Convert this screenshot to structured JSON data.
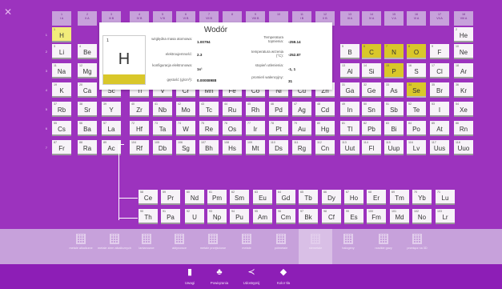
{
  "groups": [
    {
      "num": "1",
      "label": "I A"
    },
    {
      "num": "2",
      "label": "II A"
    },
    {
      "num": "3",
      "label": "III B"
    },
    {
      "num": "4",
      "label": "IV B"
    },
    {
      "num": "5",
      "label": "V B"
    },
    {
      "num": "6",
      "label": "VI B"
    },
    {
      "num": "7",
      "label": "VII B"
    },
    {
      "num": "8",
      "label": ""
    },
    {
      "num": "9",
      "label": "VIII B"
    },
    {
      "num": "10",
      "label": ""
    },
    {
      "num": "11",
      "label": "I B"
    },
    {
      "num": "12",
      "label": "II B"
    },
    {
      "num": "13",
      "label": "III A"
    },
    {
      "num": "14",
      "label": "IV A"
    },
    {
      "num": "15",
      "label": "V A"
    },
    {
      "num": "16",
      "label": "VI A"
    },
    {
      "num": "17",
      "label": "VII A"
    },
    {
      "num": "18",
      "label": "VIII A"
    }
  ],
  "periods": [
    "1",
    "2",
    "3",
    "4",
    "5",
    "6",
    "7"
  ],
  "elements": [
    [
      "1",
      "H"
    ],
    [
      "2",
      "He"
    ],
    [
      "3",
      "Li"
    ],
    [
      "4",
      "Be"
    ],
    [
      "5",
      "B"
    ],
    [
      "6",
      "C"
    ],
    [
      "7",
      "N"
    ],
    [
      "8",
      "O"
    ],
    [
      "9",
      "F"
    ],
    [
      "10",
      "Ne"
    ],
    [
      "11",
      "Na"
    ],
    [
      "12",
      "Mg"
    ],
    [
      "13",
      "Al"
    ],
    [
      "14",
      "Si"
    ],
    [
      "15",
      "P"
    ],
    [
      "16",
      "S"
    ],
    [
      "17",
      "Cl"
    ],
    [
      "18",
      "Ar"
    ],
    [
      "19",
      "K"
    ],
    [
      "20",
      "Ca"
    ],
    [
      "21",
      "Sc"
    ],
    [
      "22",
      "Ti"
    ],
    [
      "23",
      "V"
    ],
    [
      "24",
      "Cr"
    ],
    [
      "25",
      "Mn"
    ],
    [
      "26",
      "Fe"
    ],
    [
      "27",
      "Co"
    ],
    [
      "28",
      "Ni"
    ],
    [
      "29",
      "Cu"
    ],
    [
      "30",
      "Zn"
    ],
    [
      "31",
      "Ga"
    ],
    [
      "32",
      "Ge"
    ],
    [
      "33",
      "As"
    ],
    [
      "34",
      "Se"
    ],
    [
      "35",
      "Br"
    ],
    [
      "36",
      "Kr"
    ],
    [
      "37",
      "Rb"
    ],
    [
      "38",
      "Sr"
    ],
    [
      "39",
      "Y"
    ],
    [
      "40",
      "Zr"
    ],
    [
      "41",
      "Nb"
    ],
    [
      "42",
      "Mo"
    ],
    [
      "43",
      "Tc"
    ],
    [
      "44",
      "Ru"
    ],
    [
      "45",
      "Rh"
    ],
    [
      "46",
      "Pd"
    ],
    [
      "47",
      "Ag"
    ],
    [
      "48",
      "Cd"
    ],
    [
      "49",
      "In"
    ],
    [
      "50",
      "Sn"
    ],
    [
      "51",
      "Sb"
    ],
    [
      "52",
      "Te"
    ],
    [
      "53",
      "I"
    ],
    [
      "54",
      "Xe"
    ],
    [
      "55",
      "Cs"
    ],
    [
      "56",
      "Ba"
    ],
    [
      "57",
      "La"
    ],
    [
      "72",
      "Hf"
    ],
    [
      "73",
      "Ta"
    ],
    [
      "74",
      "W"
    ],
    [
      "75",
      "Re"
    ],
    [
      "76",
      "Os"
    ],
    [
      "77",
      "Ir"
    ],
    [
      "78",
      "Pt"
    ],
    [
      "79",
      "Au"
    ],
    [
      "80",
      "Hg"
    ],
    [
      "81",
      "Tl"
    ],
    [
      "82",
      "Pb"
    ],
    [
      "83",
      "Bi"
    ],
    [
      "84",
      "Po"
    ],
    [
      "85",
      "At"
    ],
    [
      "86",
      "Rn"
    ],
    [
      "87",
      "Fr"
    ],
    [
      "88",
      "Ra"
    ],
    [
      "89",
      "Ac"
    ],
    [
      "104",
      "Rf"
    ],
    [
      "105",
      "Db"
    ],
    [
      "106",
      "Sg"
    ],
    [
      "107",
      "Bh"
    ],
    [
      "108",
      "Hs"
    ],
    [
      "109",
      "Mt"
    ],
    [
      "110",
      "Ds"
    ],
    [
      "111",
      "Rg"
    ],
    [
      "112",
      "Cn"
    ],
    [
      "113",
      "Uut"
    ],
    [
      "114",
      "Fl"
    ],
    [
      "115",
      "Uup"
    ],
    [
      "116",
      "Lv"
    ],
    [
      "117",
      "Uus"
    ],
    [
      "118",
      "Uuo"
    ],
    [
      "58",
      "Ce"
    ],
    [
      "59",
      "Pr"
    ],
    [
      "60",
      "Nd"
    ],
    [
      "61",
      "Pm"
    ],
    [
      "62",
      "Sm"
    ],
    [
      "63",
      "Eu"
    ],
    [
      "64",
      "Gd"
    ],
    [
      "65",
      "Tb"
    ],
    [
      "66",
      "Dy"
    ],
    [
      "67",
      "Ho"
    ],
    [
      "68",
      "Er"
    ],
    [
      "69",
      "Tm"
    ],
    [
      "70",
      "Yb"
    ],
    [
      "71",
      "Lu"
    ],
    [
      "90",
      "Th"
    ],
    [
      "91",
      "Pa"
    ],
    [
      "92",
      "U"
    ],
    [
      "93",
      "Np"
    ],
    [
      "94",
      "Pu"
    ],
    [
      "95",
      "Am"
    ],
    [
      "96",
      "Cm"
    ],
    [
      "97",
      "Bk"
    ],
    [
      "98",
      "Cf"
    ],
    [
      "99",
      "Es"
    ],
    [
      "100",
      "Fm"
    ],
    [
      "101",
      "Md"
    ],
    [
      "102",
      "No"
    ],
    [
      "103",
      "Lr"
    ]
  ],
  "popup": {
    "title": "Wodór",
    "number": "1",
    "symbol": "H",
    "props": [
      {
        "label": "względna masa atomowa:",
        "value": "1.00794"
      },
      {
        "label": "elektroujemność:",
        "value": "2.3"
      },
      {
        "label": "konfiguracja elektronowa:",
        "value": "1s¹"
      },
      {
        "label": "gęstość (g/cm³):",
        "value": "0.00008988"
      },
      {
        "label": "Temperatura topnienia:",
        "value": "-259.14"
      },
      {
        "label": "temperatura wrzenia (°C):",
        "value": "-252.87"
      },
      {
        "label": "stopień utlenienia:",
        "value": "-1, 1"
      },
      {
        "label": "promień walencyjny:",
        "value": "31"
      }
    ]
  },
  "categories": [
    {
      "label": "metale alkaliczne"
    },
    {
      "label": "metale ziem alkalicznych"
    },
    {
      "label": "lantanowce"
    },
    {
      "label": "aktynowce"
    },
    {
      "label": "metale przejściowe"
    },
    {
      "label": "metale"
    },
    {
      "label": "półmetale"
    },
    {
      "label": "niemetale"
    },
    {
      "label": "halogeny"
    },
    {
      "label": "rzadkie gazy"
    },
    {
      "label": "przełącz na 3D"
    }
  ],
  "toolbar": [
    {
      "icon": "book",
      "label": "Uwagi"
    },
    {
      "icon": "sitemap",
      "label": "Powiązania"
    },
    {
      "icon": "share",
      "label": "Udostępnij"
    },
    {
      "icon": "paint-bucket",
      "label": "Kolor tła"
    }
  ],
  "colors": {
    "background": "#9c33be",
    "highlight": "#d9c72a",
    "selected": "#f2ec7a",
    "toolbar": "#8d1eb6"
  }
}
